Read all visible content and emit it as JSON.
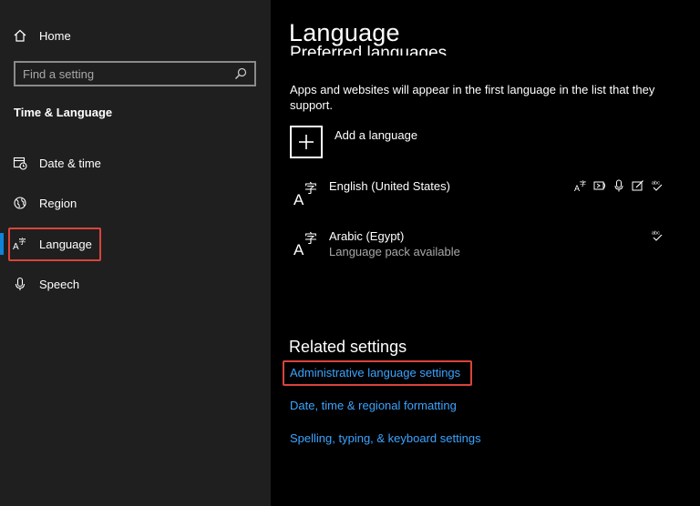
{
  "sidebar": {
    "home_label": "Home",
    "search_placeholder": "Find a setting",
    "section_title": "Time & Language",
    "items": [
      {
        "label": "Date & time",
        "icon": "calendar-clock-icon"
      },
      {
        "label": "Region",
        "icon": "globe-icon"
      },
      {
        "label": "Language",
        "icon": "language-icon",
        "active": true
      },
      {
        "label": "Speech",
        "icon": "microphone-icon"
      }
    ]
  },
  "main": {
    "title": "Language",
    "cut_heading": "Preferred languages",
    "description": "Apps and websites will appear in the first language in the list that they support.",
    "add_language_label": "Add a language",
    "languages": [
      {
        "name": "English (United States)",
        "sub": "",
        "features": [
          "display-language-icon",
          "text-to-speech-icon",
          "speech-recognition-icon",
          "handwriting-icon",
          "spell-check-icon"
        ]
      },
      {
        "name": "Arabic (Egypt)",
        "sub": "Language pack available",
        "features": [
          "spell-check-icon"
        ]
      }
    ],
    "related_title": "Related settings",
    "links": [
      "Administrative language settings",
      "Date, time & regional formatting",
      "Spelling, typing, & keyboard settings"
    ]
  },
  "colors": {
    "accent": "#0f84d9",
    "link": "#3ba4ff",
    "highlight": "#d9443b",
    "sidebar_bg": "#1f1f1f",
    "main_bg": "#000000"
  }
}
